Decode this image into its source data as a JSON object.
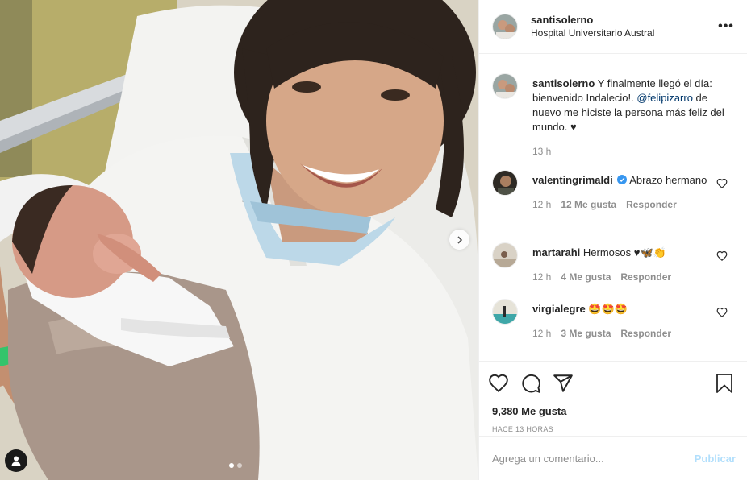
{
  "post": {
    "username": "santisolerno",
    "location": "Hospital Universitario Austral",
    "more_label": "•••"
  },
  "caption": {
    "username": "santisolerno",
    "text_before": "Y finalmente llegó el día: bienvenido Indalecio!. ",
    "mention": "@felipizarro",
    "text_after": " de nuevo me hiciste la persona más feliz del mundo. ♥",
    "time": "13 h"
  },
  "comments": [
    {
      "username": "valentingrimaldi",
      "verified": true,
      "text": "Abrazo hermano",
      "time": "12 h",
      "likes": "12 Me gusta",
      "reply": "Responder"
    },
    {
      "username": "martarahi",
      "verified": false,
      "text": "Hermosos ♥🦋👏",
      "time": "12 h",
      "likes": "4 Me gusta",
      "reply": "Responder"
    },
    {
      "username": "virgialegre",
      "verified": false,
      "text": "🤩🤩🤩",
      "time": "12 h",
      "likes": "3 Me gusta",
      "reply": "Responder"
    }
  ],
  "stats": {
    "likes": "9,380 Me gusta",
    "posted": "HACE 13 HORAS"
  },
  "add_comment": {
    "placeholder": "Agrega un comentario...",
    "publish": "Publicar"
  },
  "icons": {
    "like": "heart-icon",
    "comment": "comment-icon",
    "share": "share-icon",
    "save": "bookmark-icon",
    "next": "chevron-right-icon",
    "tags": "user-tag-icon"
  },
  "colors": {
    "text": "#262626",
    "muted": "#8e8e8e",
    "mention": "#00376b",
    "verified": "#3897f0",
    "publish_disabled": "#b2dffc",
    "border": "#efefef"
  },
  "carousel": {
    "count": 2,
    "active_index": 0
  }
}
